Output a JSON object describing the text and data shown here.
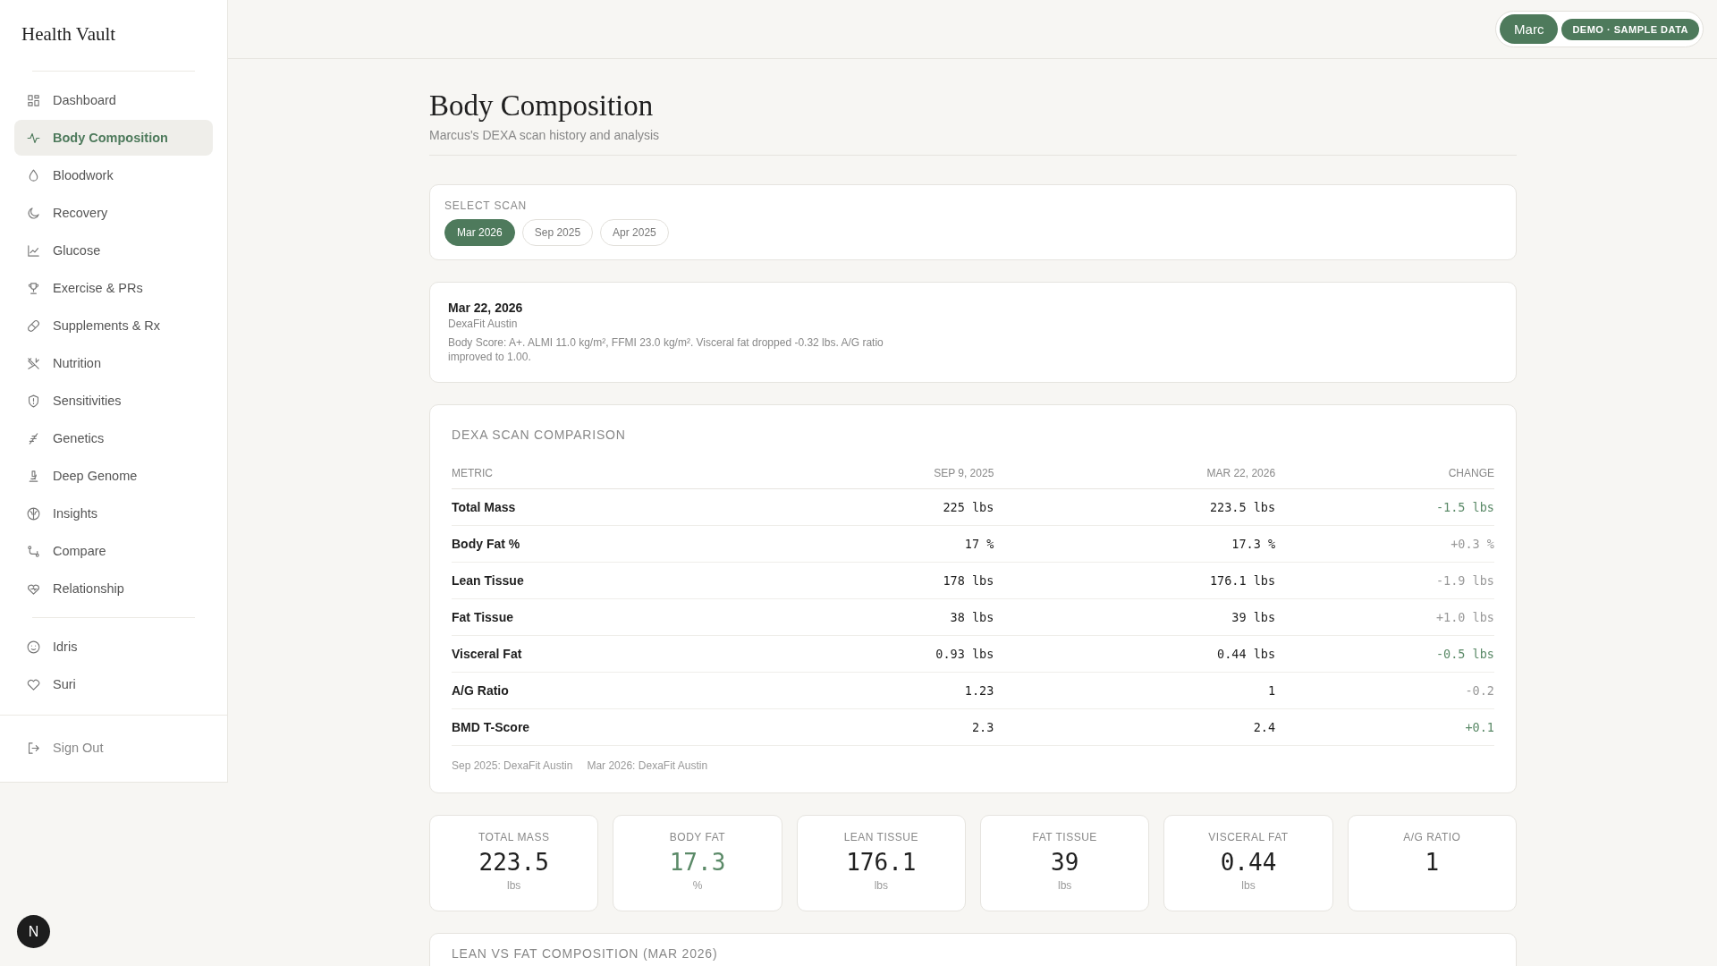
{
  "brand": "Health Vault",
  "nav": [
    {
      "label": "Dashboard",
      "selected": false
    },
    {
      "label": "Body Composition",
      "selected": true
    },
    {
      "label": "Bloodwork",
      "selected": false
    },
    {
      "label": "Recovery",
      "selected": false
    },
    {
      "label": "Glucose",
      "selected": false
    },
    {
      "label": "Exercise & PRs",
      "selected": false
    },
    {
      "label": "Supplements & Rx",
      "selected": false
    },
    {
      "label": "Nutrition",
      "selected": false
    },
    {
      "label": "Sensitivities",
      "selected": false
    },
    {
      "label": "Genetics",
      "selected": false
    },
    {
      "label": "Deep Genome",
      "selected": false
    },
    {
      "label": "Insights",
      "selected": false
    },
    {
      "label": "Compare",
      "selected": false
    },
    {
      "label": "Relationship",
      "selected": false
    }
  ],
  "profiles": [
    {
      "label": "Idris",
      "selected": false
    },
    {
      "label": "Suri",
      "selected": false
    }
  ],
  "sign_out": "Sign Out",
  "user_button": "Marc",
  "demo_badge": "DEMO · SAMPLE DATA",
  "dev_badge": "N",
  "page": {
    "title": "Body Composition",
    "subtitle": "Marcus's DEXA scan history and analysis"
  },
  "scan_select": {
    "label": "SELECT SCAN",
    "options": [
      {
        "label": "Mar 2026",
        "selected": true
      },
      {
        "label": "Sep 2025",
        "selected": false
      },
      {
        "label": "Apr 2025",
        "selected": false
      }
    ]
  },
  "scan_note": {
    "date": "Mar 22, 2026",
    "location": "DexaFit Austin",
    "text": "Body Score: A+. ALMI 11.0 kg/m², FFMI 23.0 kg/m². Visceral fat dropped -0.32 lbs. A/G ratio improved to 1.00."
  },
  "comparison": {
    "title": "DEXA SCAN COMPARISON",
    "columns": [
      "METRIC",
      "SEP 9, 2025",
      "MAR 22, 2026",
      "CHANGE"
    ],
    "rows": [
      {
        "metric": "Total Mass",
        "before": "225 lbs",
        "after": "223.5 lbs",
        "change": "-1.5 lbs",
        "improved": true
      },
      {
        "metric": "Body Fat %",
        "before": "17 %",
        "after": "17.3 %",
        "change": "+0.3 %",
        "improved": false
      },
      {
        "metric": "Lean Tissue",
        "before": "178 lbs",
        "after": "176.1 lbs",
        "change": "-1.9 lbs",
        "improved": false
      },
      {
        "metric": "Fat Tissue",
        "before": "38 lbs",
        "after": "39 lbs",
        "change": "+1.0 lbs",
        "improved": false
      },
      {
        "metric": "Visceral Fat",
        "before": "0.93 lbs",
        "after": "0.44 lbs",
        "change": "-0.5 lbs",
        "improved": true
      },
      {
        "metric": "A/G Ratio",
        "before": "1.23",
        "after": "1",
        "change": "-0.2",
        "improved": false
      },
      {
        "metric": "BMD T-Score",
        "before": "2.3",
        "after": "2.4",
        "change": "+0.1",
        "improved": true
      }
    ],
    "sources": [
      "Sep 2025: DexaFit Austin",
      "Mar 2026: DexaFit Austin"
    ]
  },
  "stats": [
    {
      "label": "TOTAL MASS",
      "value": "223.5",
      "unit": "lbs",
      "highlight": false
    },
    {
      "label": "BODY FAT",
      "value": "17.3",
      "unit": "%",
      "highlight": true
    },
    {
      "label": "LEAN TISSUE",
      "value": "176.1",
      "unit": "lbs",
      "highlight": false
    },
    {
      "label": "FAT TISSUE",
      "value": "39",
      "unit": "lbs",
      "highlight": false
    },
    {
      "label": "VISCERAL FAT",
      "value": "0.44",
      "unit": "lbs",
      "highlight": false
    },
    {
      "label": "A/G RATIO",
      "value": "1",
      "highlight": false
    }
  ],
  "composition_card": {
    "title": "LEAN VS FAT COMPOSITION (MAR 2026)"
  }
}
